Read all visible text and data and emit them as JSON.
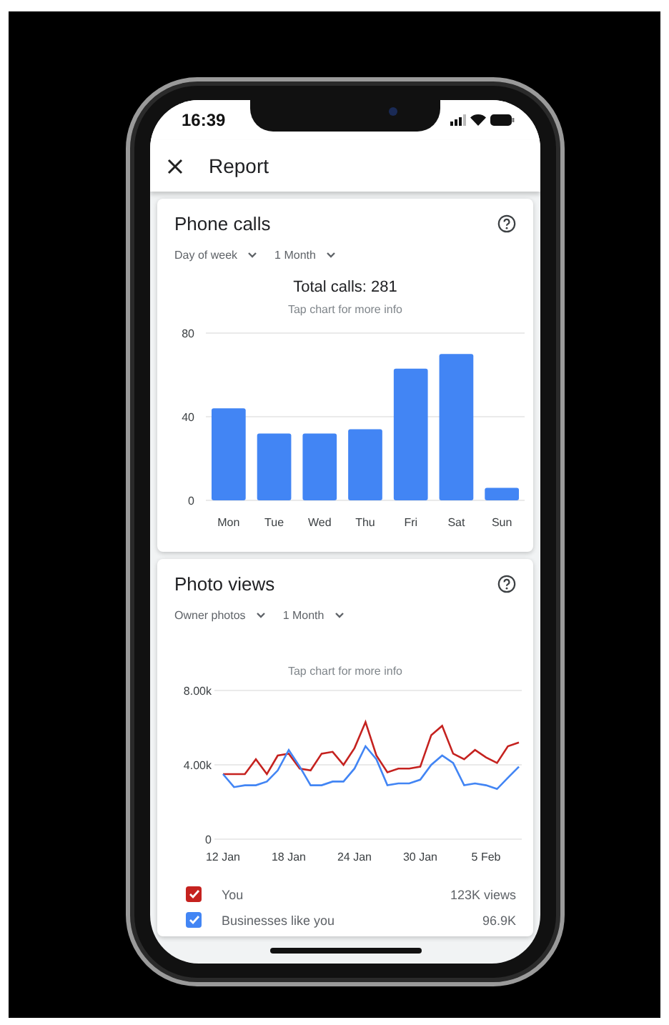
{
  "status_bar": {
    "time": "16:39"
  },
  "header": {
    "title": "Report"
  },
  "cards": [
    {
      "title": "Phone calls",
      "filters": [
        "Day of week",
        "1 Month"
      ],
      "total": "Total calls: 281",
      "hint": "Tap chart for more info",
      "chart_data": {
        "type": "bar",
        "categories": [
          "Mon",
          "Tue",
          "Wed",
          "Thu",
          "Fri",
          "Sat",
          "Sun"
        ],
        "series": [
          {
            "color": "#4285f4",
            "values": [
              44,
              32,
              32,
              34,
              63,
              70,
              6
            ]
          }
        ],
        "ylim": [
          0,
          80
        ],
        "yticks": [
          0,
          40,
          80
        ]
      }
    },
    {
      "title": "Photo views",
      "filters": [
        "Owner photos",
        "1 Month"
      ],
      "hint": "Tap chart for more info",
      "chart_data": {
        "type": "line",
        "categories": [
          "12 Jan",
          null,
          null,
          null,
          null,
          null,
          "18 Jan",
          null,
          null,
          null,
          null,
          null,
          "24 Jan",
          null,
          null,
          null,
          null,
          null,
          "30 Jan",
          null,
          null,
          null,
          null,
          null,
          "5 Feb",
          null,
          null,
          null
        ],
        "series": [
          {
            "color": "#c5221f",
            "values": [
              3500,
              3500,
              3500,
              4300,
              3500,
              4500,
              4600,
              3800,
              3700,
              4600,
              4700,
              4000,
              4900,
              6300,
              4500,
              3600,
              3800,
              3800,
              3900,
              5600,
              6100,
              4600,
              4300,
              4800,
              4400,
              4100,
              5000,
              5200
            ]
          },
          {
            "color": "#4285f4",
            "values": [
              3500,
              2800,
              2900,
              2900,
              3100,
              3700,
              4800,
              3900,
              2900,
              2900,
              3100,
              3100,
              3800,
              5000,
              4300,
              2900,
              3000,
              3000,
              3200,
              4000,
              4500,
              4100,
              2900,
              3000,
              2900,
              2700,
              3300,
              3900
            ]
          }
        ],
        "ylim": [
          0,
          8000
        ],
        "yticks": [
          0,
          {
            "value": 4000,
            "label": "4.00k"
          },
          {
            "value": 8000,
            "label": "8.00k"
          }
        ]
      },
      "legend": [
        {
          "label": "You",
          "value": "123K views",
          "color": "#c5221f",
          "checked": true
        },
        {
          "label": "Businesses like you",
          "value": "96.9K",
          "color": "#4285f4",
          "checked": true
        }
      ]
    }
  ]
}
